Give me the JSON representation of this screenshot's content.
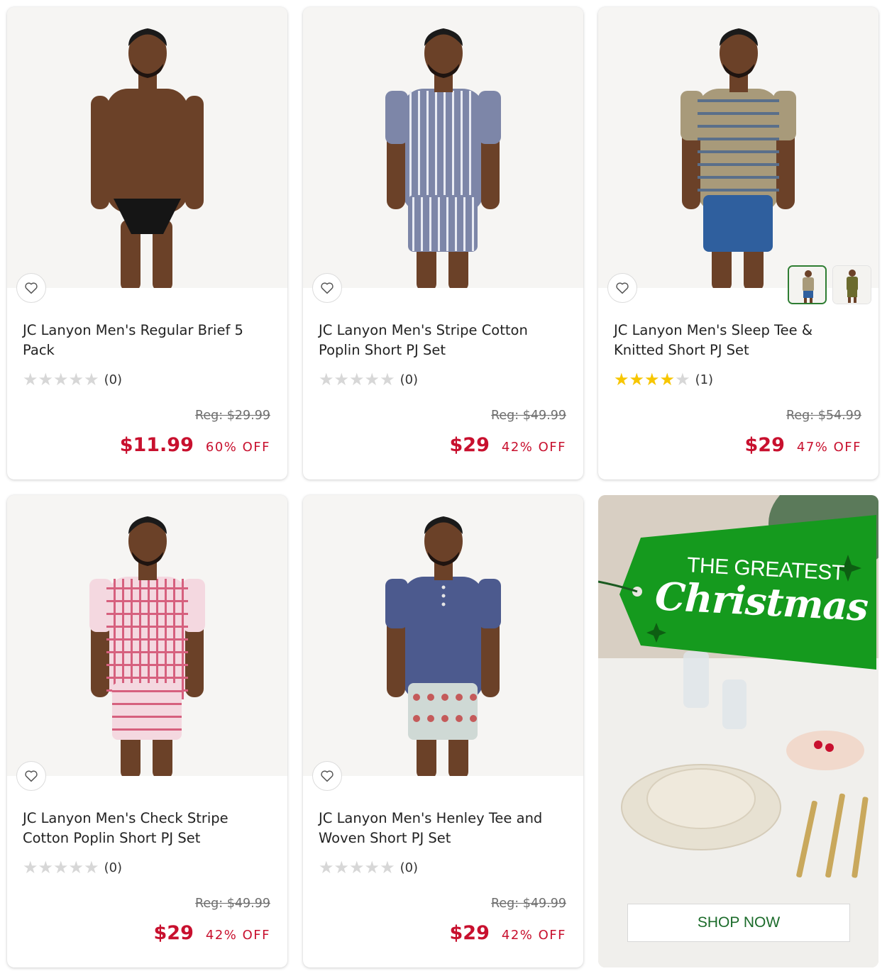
{
  "colors": {
    "price_red": "#c8102e",
    "star_gold": "#f7c600",
    "star_gray": "#d7d7d7",
    "promo_green": "#159a1e"
  },
  "products": [
    {
      "title": "JC Lanyon Men's Regular Brief 5 Pack",
      "rating": 0,
      "review_count": "(0)",
      "reg_price": "Reg: $29.99",
      "price": "$11.99",
      "discount": "60% OFF",
      "image": "man-in-black-brief"
    },
    {
      "title": "JC Lanyon Men's Stripe Cotton Poplin Short PJ Set",
      "rating": 0,
      "review_count": "(0)",
      "reg_price": "Reg: $49.99",
      "price": "$29",
      "discount": "42% OFF",
      "image": "man-in-blue-stripe-pj"
    },
    {
      "title": "JC Lanyon Men's Sleep Tee & Knitted Short PJ Set",
      "rating": 4,
      "review_count": "(1)",
      "reg_price": "Reg: $54.99",
      "price": "$29",
      "discount": "47% OFF",
      "image": "man-in-striped-tee-blue-shorts",
      "swatches": [
        "striped-tee-variant",
        "olive-set-variant"
      ]
    },
    {
      "title": "JC Lanyon Men's Check Stripe Cotton Poplin Short PJ Set",
      "rating": 0,
      "review_count": "(0)",
      "reg_price": "Reg: $49.99",
      "price": "$29",
      "discount": "42% OFF",
      "image": "man-in-pink-check-pj"
    },
    {
      "title": "JC Lanyon Men's Henley Tee and Woven Short PJ Set",
      "rating": 0,
      "review_count": "(0)",
      "reg_price": "Reg: $49.99",
      "price": "$29",
      "discount": "42% OFF",
      "image": "man-in-navy-henley"
    }
  ],
  "promo": {
    "line1": "THE GREATEST",
    "line2": "Christmas",
    "cta": "SHOP NOW"
  }
}
